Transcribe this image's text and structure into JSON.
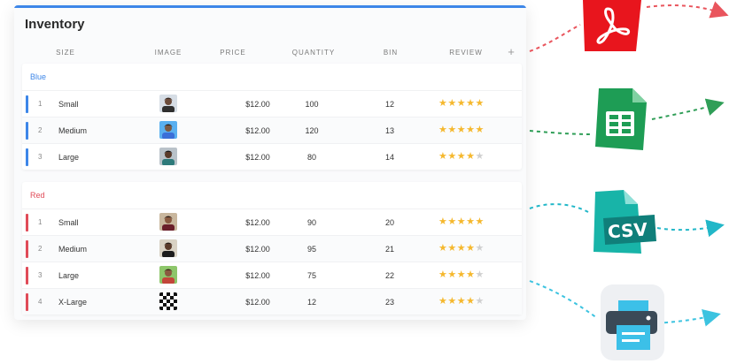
{
  "app": {
    "title": "Inventory"
  },
  "columns": [
    "SIZE",
    "IMAGE",
    "PRICE",
    "QUANTITY",
    "BIN",
    "REVIEW"
  ],
  "add_column_label": "+",
  "colors": {
    "accent": "#3d86e8",
    "blue_group": "#3d86e8",
    "red_group": "#e04b58",
    "star": "#f5b82e"
  },
  "groups": [
    {
      "label": "Blue",
      "rows": [
        {
          "num": "1",
          "size": "Small",
          "price": "$12.00",
          "quantity": "100",
          "bin": "12",
          "rating": 5
        },
        {
          "num": "2",
          "size": "Medium",
          "price": "$12.00",
          "quantity": "120",
          "bin": "13",
          "rating": 5
        },
        {
          "num": "3",
          "size": "Large",
          "price": "$12.00",
          "quantity": "80",
          "bin": "14",
          "rating": 4
        }
      ]
    },
    {
      "label": "Red",
      "rows": [
        {
          "num": "1",
          "size": "Small",
          "price": "$12.00",
          "quantity": "90",
          "bin": "20",
          "rating": 5
        },
        {
          "num": "2",
          "size": "Medium",
          "price": "$12.00",
          "quantity": "95",
          "bin": "21",
          "rating": 4
        },
        {
          "num": "3",
          "size": "Large",
          "price": "$12.00",
          "quantity": "75",
          "bin": "22",
          "rating": 4
        },
        {
          "num": "4",
          "size": "X-Large",
          "price": "$12.00",
          "quantity": "12",
          "bin": "23",
          "rating": 4
        }
      ]
    }
  ],
  "export_icons": {
    "pdf": "pdf-icon",
    "sheets": "spreadsheet-icon",
    "csv": "CSV",
    "print": "printer-icon"
  }
}
